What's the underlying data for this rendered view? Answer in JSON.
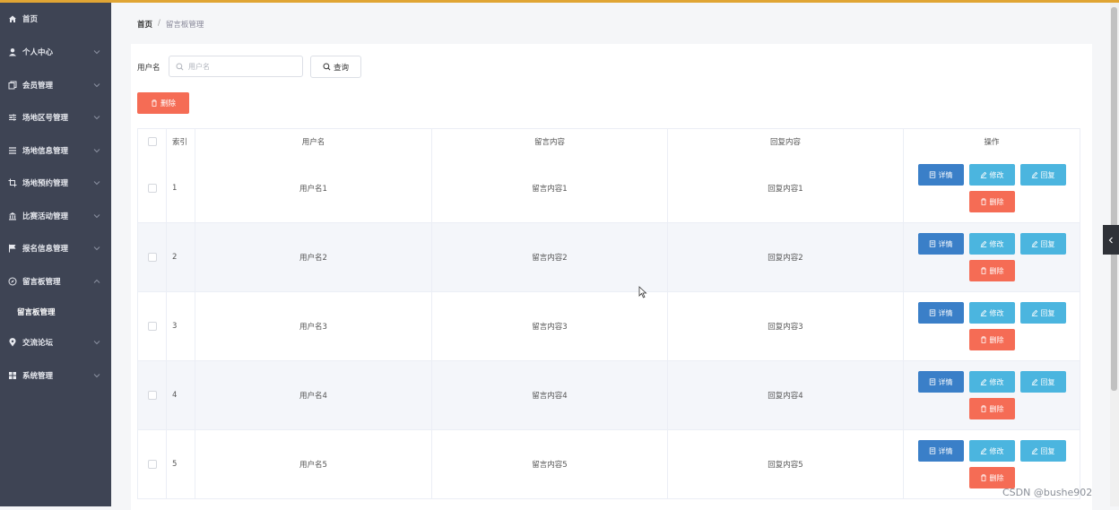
{
  "sidebar": {
    "items": [
      {
        "label": "首页",
        "icon": "home-icon"
      },
      {
        "label": "个人中心",
        "icon": "user-icon"
      },
      {
        "label": "会员管理",
        "icon": "copy-icon"
      },
      {
        "label": "场地区号管理",
        "icon": "sliders-icon"
      },
      {
        "label": "场地信息管理",
        "icon": "list-icon"
      },
      {
        "label": "场地预约管理",
        "icon": "crop-icon"
      },
      {
        "label": "比赛活动管理",
        "icon": "bank-icon"
      },
      {
        "label": "报名信息管理",
        "icon": "flag-icon"
      },
      {
        "label": "留言板管理",
        "icon": "compass-icon"
      },
      {
        "label": "交流论坛",
        "icon": "location-icon"
      },
      {
        "label": "系统管理",
        "icon": "grid-icon"
      }
    ],
    "submenu": {
      "label": "留言板管理"
    }
  },
  "breadcrumb": {
    "home": "首页",
    "separator": "/",
    "current": "留言板管理"
  },
  "search": {
    "label": "用户名",
    "placeholder": "用户名",
    "value": "",
    "button": "查询"
  },
  "toolbar": {
    "bulk_delete": "删除"
  },
  "table": {
    "headers": {
      "index": "索引",
      "username": "用户名",
      "content": "留言内容",
      "reply": "回复内容",
      "actions": "操作"
    },
    "rows": [
      {
        "index": "1",
        "username": "用户名1",
        "content": "留言内容1",
        "reply": "回复内容1"
      },
      {
        "index": "2",
        "username": "用户名2",
        "content": "留言内容2",
        "reply": "回复内容2"
      },
      {
        "index": "3",
        "username": "用户名3",
        "content": "留言内容3",
        "reply": "回复内容3"
      },
      {
        "index": "4",
        "username": "用户名4",
        "content": "留言内容4",
        "reply": "回复内容4"
      },
      {
        "index": "5",
        "username": "用户名5",
        "content": "留言内容5",
        "reply": "回复内容5"
      }
    ],
    "actions": {
      "detail": "详情",
      "edit": "修改",
      "reply": "回复",
      "delete": "删除"
    }
  },
  "watermark": "CSDN @bushe902",
  "colors": {
    "sidebar": "#3e4454",
    "accent_top": "#e0a534",
    "primary": "#3a7fc8",
    "info": "#4bb5df",
    "danger": "#f56c55"
  }
}
